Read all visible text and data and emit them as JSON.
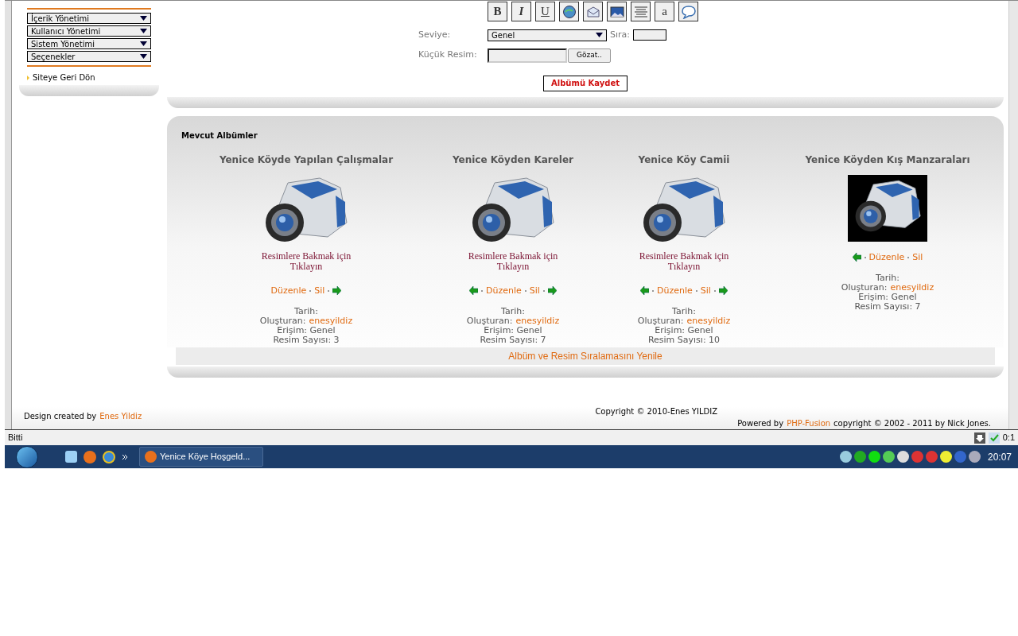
{
  "sidebar": {
    "menus": [
      {
        "label": "İçerik Yönetimi"
      },
      {
        "label": "Kullanıcı Yönetimi"
      },
      {
        "label": "Sistem Yönetimi"
      },
      {
        "label": "Seçenekler"
      }
    ],
    "back_link": "Siteye Geri Dön"
  },
  "editor": {
    "toolbar": [
      {
        "kind": "bold",
        "label": "B"
      },
      {
        "kind": "italic",
        "label": "I"
      },
      {
        "kind": "underline",
        "label": "U"
      },
      {
        "kind": "link"
      },
      {
        "kind": "mail"
      },
      {
        "kind": "image"
      },
      {
        "kind": "center"
      },
      {
        "kind": "font",
        "label": "a"
      },
      {
        "kind": "quote"
      }
    ],
    "level_label": "Seviye:",
    "level_value": "Genel",
    "order_label": "Sıra:",
    "thumb_label": "Küçük Resim:",
    "browse_button": "Gözat..",
    "save_button": "Albümü Kaydet"
  },
  "albums_panel": {
    "title": "Mevcut Albümler",
    "albums": [
      {
        "title": "Yenice Köyde Yapılan Çalışmalar",
        "kind": "camera",
        "caption": "Resimlere Bakmak için Tıklayın",
        "has_prev": false,
        "has_next": true,
        "edit": "Düzenle",
        "delete": "Sil",
        "date_label": "Tarih:",
        "author_label": "Oluşturan:",
        "author": "enesyildiz",
        "access": "Erişim: Genel",
        "count": "Resim Sayısı: 3"
      },
      {
        "title": "Yenice Köyden Kareler",
        "kind": "camera",
        "caption": "Resimlere Bakmak için Tıklayın",
        "has_prev": true,
        "has_next": true,
        "edit": "Düzenle",
        "delete": "Sil",
        "date_label": "Tarih:",
        "author_label": "Oluşturan:",
        "author": "enesyildiz",
        "access": "Erişim: Genel",
        "count": "Resim Sayısı: 7"
      },
      {
        "title": "Yenice Köy Camii",
        "kind": "camera",
        "caption": "Resimlere Bakmak için Tıklayın",
        "has_prev": true,
        "has_next": true,
        "edit": "Düzenle",
        "delete": "Sil",
        "date_label": "Tarih:",
        "author_label": "Oluşturan:",
        "author": "enesyildiz",
        "access": "Erişim: Genel",
        "count": "Resim Sayısı: 10"
      },
      {
        "title": "Yenice Köyden Kış Manzaraları",
        "kind": "camera_dark",
        "has_prev": true,
        "has_next": false,
        "edit": "Düzenle",
        "delete": "Sil",
        "date_label": "Tarih:",
        "author_label": "Oluşturan:",
        "author": "enesyildiz",
        "access": "Erişim: Genel",
        "count": "Resim Sayısı: 7"
      }
    ],
    "refresh_link": "Albüm ve Resim Sıralamasını Yenile"
  },
  "footer": {
    "design_prefix": "Design created by",
    "designer": "Enes Yildiz",
    "copyright": "Copyright © 2010-Enes YILDIZ",
    "powered_prefix": "Powered by",
    "powered_link": "PHP-Fusion",
    "powered_suffix": "copyright © 2002 - 2011 by Nick Jones."
  },
  "status_bar": {
    "text": "Bitti",
    "clock_fragment": "0:1"
  },
  "taskbar": {
    "window_title": "Yenice Köye Hoşgeld...",
    "time": "20:07"
  }
}
